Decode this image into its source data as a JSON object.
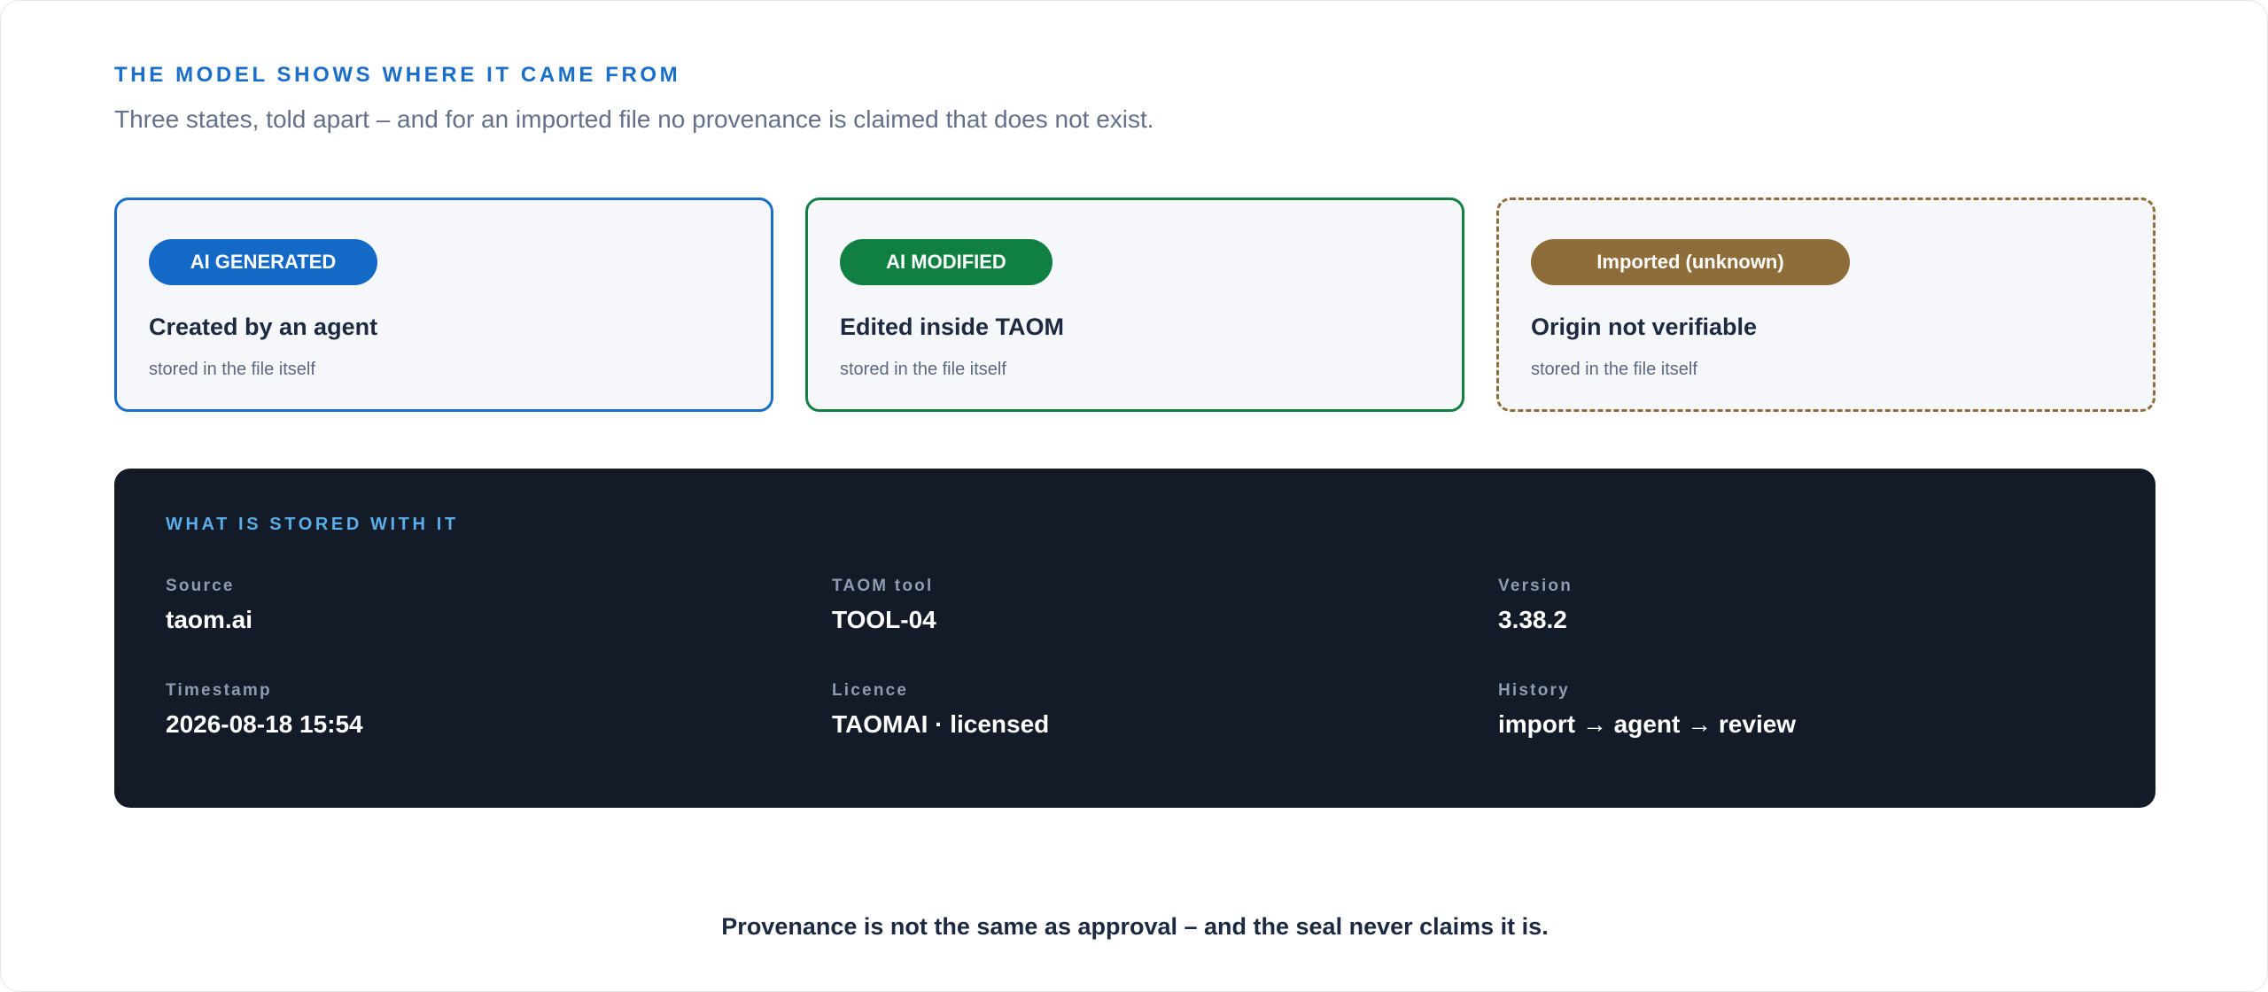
{
  "header": {
    "eyebrow": "THE MODEL SHOWS WHERE IT CAME FROM",
    "subtitle": "Three states, told apart – and for an imported file no provenance is claimed that does not exist."
  },
  "states": [
    {
      "badge": "AI GENERATED",
      "title": "Created by an agent",
      "note": "stored in the file itself",
      "color": "#1469c7"
    },
    {
      "badge": "AI MODIFIED",
      "title": "Edited inside TAOM",
      "note": "stored in the file itself",
      "color": "#0f8041"
    },
    {
      "badge": "Imported (unknown)",
      "title": "Origin not verifiable",
      "note": "stored in the file itself",
      "color": "#8e6d3a"
    }
  ],
  "stored": {
    "heading": "WHAT IS STORED WITH IT",
    "fields": [
      {
        "label": "Source",
        "value": "taom.ai"
      },
      {
        "label": "TAOM tool",
        "value": "TOOL-04"
      },
      {
        "label": "Version",
        "value": "3.38.2"
      },
      {
        "label": "Timestamp",
        "value": "2026-08-18 15:54"
      },
      {
        "label": "Licence",
        "value": "TAOMAI · licensed"
      },
      {
        "label": "History",
        "value": "import → agent → review"
      }
    ]
  },
  "footer": {
    "text": "Provenance is not the same as approval – and the seal never claims it is."
  }
}
